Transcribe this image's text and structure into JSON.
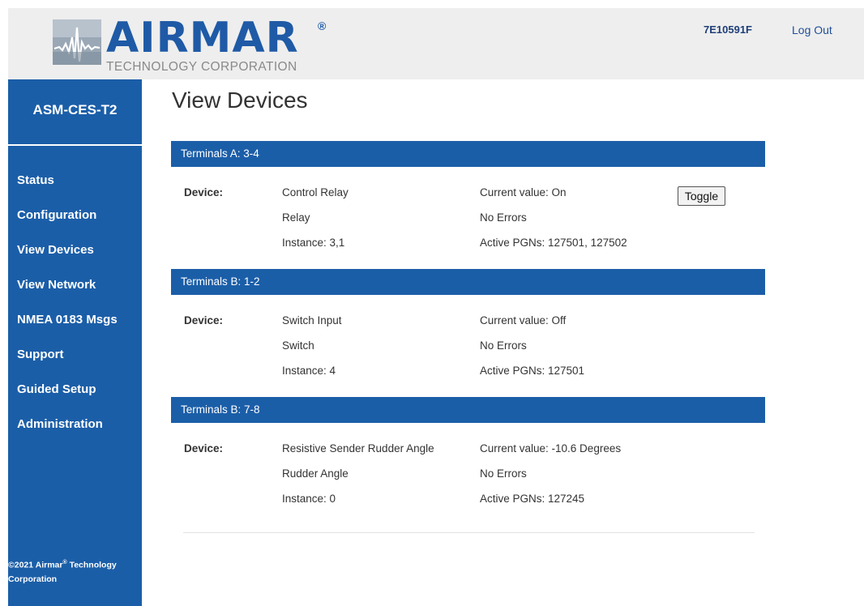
{
  "header": {
    "brand": "AIRMAR",
    "brand_mark": "®",
    "brand_sub": "TECHNOLOGY CORPORATION",
    "device_id": "7E10591F",
    "logout_label": "Log Out"
  },
  "sidebar": {
    "title": "ASM-CES-T2",
    "items": [
      {
        "label": "Status"
      },
      {
        "label": "Configuration"
      },
      {
        "label": "View Devices"
      },
      {
        "label": "View Network"
      },
      {
        "label": "NMEA 0183 Msgs"
      },
      {
        "label": "Support"
      },
      {
        "label": "Guided Setup"
      },
      {
        "label": "Administration"
      }
    ],
    "copyright_pre": "©2021 Airmar",
    "copyright_sup": "®",
    "copyright_post": " Technology Corporation"
  },
  "main": {
    "title": "View Devices",
    "sections": [
      {
        "header": "Terminals A: 3-4",
        "device_label": "Device:",
        "name": "Control Relay",
        "type": "Relay",
        "instance": "Instance: 3,1",
        "current_value": "Current value: On",
        "errors": "No Errors",
        "pgns": "Active PGNs: 127501, 127502",
        "button_label": "Toggle"
      },
      {
        "header": "Terminals B: 1-2",
        "device_label": "Device:",
        "name": "Switch Input",
        "type": "Switch",
        "instance": "Instance: 4",
        "current_value": "Current value: Off",
        "errors": "No Errors",
        "pgns": "Active PGNs: 127501"
      },
      {
        "header": "Terminals B: 7-8",
        "device_label": "Device:",
        "name": "Resistive Sender Rudder Angle",
        "type": "Rudder Angle",
        "instance": "Instance: 0",
        "current_value": "Current value: -10.6 Degrees",
        "errors": "No Errors",
        "pgns": "Active PGNs: 127245"
      }
    ]
  },
  "colors": {
    "brand_blue": "#1b5ea8",
    "header_bg": "#eeeeee",
    "logo_text": "#1f5aa6",
    "logo_sub": "#8a8a8a"
  }
}
